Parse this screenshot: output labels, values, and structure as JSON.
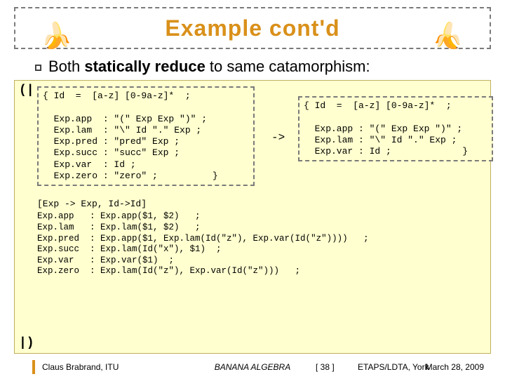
{
  "title": "Example cont'd",
  "bullet": {
    "prefix": "Both ",
    "strong": "statically reduce",
    "suffix": " to same catamorphism:"
  },
  "sym_open": "(|",
  "sym_close": "|)",
  "grammar_left": "{ Id  =  [a-z] [0-9a-z]*  ;\n\n  Exp.app  : \"(\" Exp Exp \")\" ;\n  Exp.lam  : \"\\\" Id \".\" Exp ;\n  Exp.pred : \"pred\" Exp ;\n  Exp.succ : \"succ\" Exp ;\n  Exp.var  : Id ;\n  Exp.zero : \"zero\" ;          }",
  "arrow": "->",
  "grammar_right": "{ Id  =  [a-z] [0-9a-z]*  ;\n\n  Exp.app : \"(\" Exp Exp \")\" ;\n  Exp.lam : \"\\\" Id \".\" Exp ;\n  Exp.var : Id ;             }",
  "midline": "[Exp -> Exp, Id->Id]",
  "rules": "Exp.app   : Exp.app($1, $2)   ;\nExp.lam   : Exp.lam($1, $2)   ;\nExp.pred  : Exp.app($1, Exp.lam(Id(\"z\"), Exp.var(Id(\"z\"))))   ;\nExp.succ  : Exp.lam(Id(\"x\"), $1)  ;\nExp.var   : Exp.var($1)  ;\nExp.zero  : Exp.lam(Id(\"z\"), Exp.var(Id(\"z\")))   ;",
  "footer": {
    "author": "Claus Brabrand, ITU",
    "center": "BANANA ALGEBRA",
    "page": "[ 38 ]",
    "venue": "ETAPS/LDTA, York",
    "date": "March 28, 2009"
  },
  "banana_glyph": ")"
}
